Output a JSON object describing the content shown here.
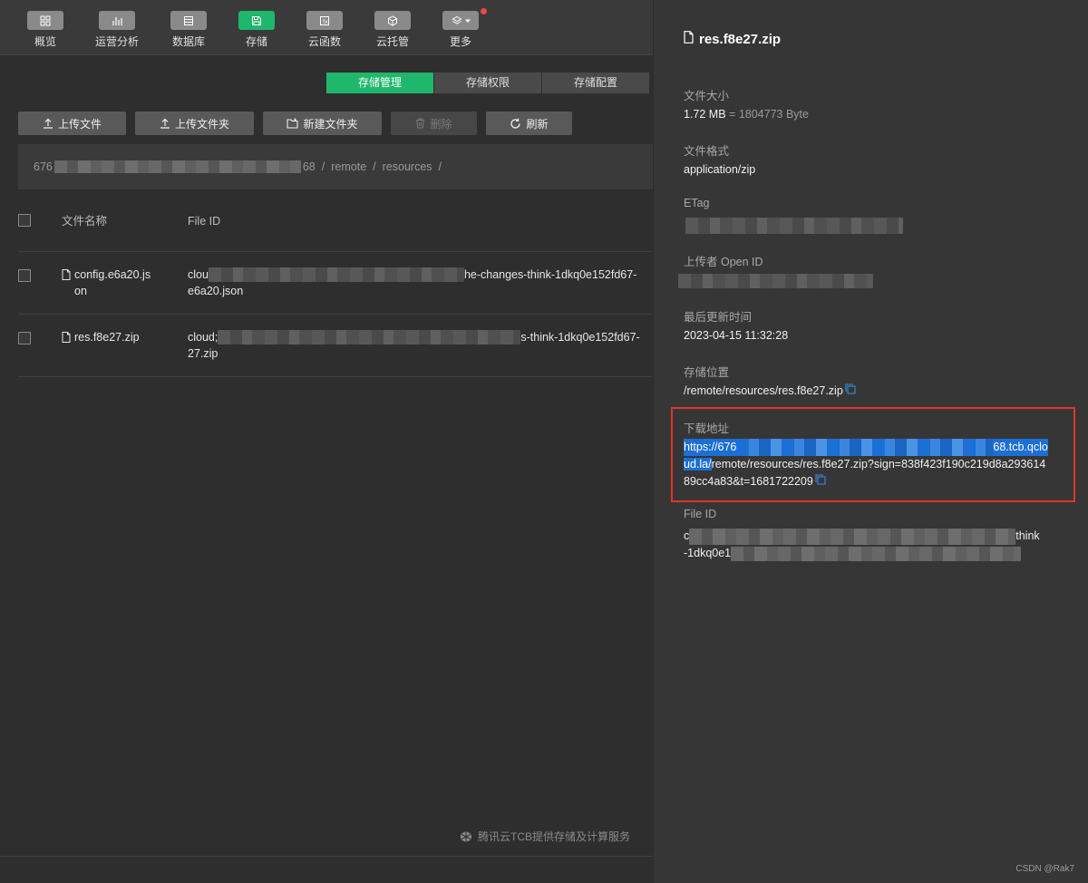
{
  "nav": {
    "items": [
      {
        "label": "概览",
        "icon": "grid-icon"
      },
      {
        "label": "运营分析",
        "icon": "bar-chart-icon"
      },
      {
        "label": "数据库",
        "icon": "database-icon"
      },
      {
        "label": "存储",
        "icon": "save-icon",
        "active": true
      },
      {
        "label": "云函数",
        "icon": "function-icon"
      },
      {
        "label": "云托管",
        "icon": "cube-icon"
      },
      {
        "label": "更多",
        "icon": "layers-icon"
      }
    ]
  },
  "tabs": [
    {
      "label": "存储管理",
      "active": true
    },
    {
      "label": "存储权限"
    },
    {
      "label": "存储配置"
    }
  ],
  "toolbar": {
    "upload_file": "上传文件",
    "upload_folder": "上传文件夹",
    "new_folder": "新建文件夹",
    "delete": "删除",
    "refresh": "刷新"
  },
  "breadcrumb": {
    "prefix": "676",
    "suffix": "68",
    "parts": [
      "remote",
      "resources"
    ],
    "separator": "/"
  },
  "table": {
    "headers": {
      "name": "文件名称",
      "file_id": "File ID"
    },
    "rows": [
      {
        "name_l1": "config.e6a20.js",
        "name_l2": "on",
        "id_prefix": "clou",
        "id_suffix": "he-changes-think-1dkq0e152fd67-",
        "id_l2": "e6a20.json"
      },
      {
        "name_l1": "res.f8e27.zip",
        "name_l2": "",
        "id_prefix": "cloud;",
        "id_suffix": "s-think-1dkq0e152fd67-",
        "id_l2": "27.zip"
      }
    ]
  },
  "footer": {
    "brand": "腾讯云TCB提供存储及计算服务"
  },
  "panel": {
    "title": "res.f8e27.zip",
    "size_label": "文件大小",
    "size_value": "1.72 MB",
    "size_bytes": "= 1804773 Byte",
    "format_label": "文件格式",
    "format_value": "application/zip",
    "etag_label": "ETag",
    "uploader_label": "上传者 Open ID",
    "updated_label": "最后更新时间",
    "updated_value": "2023-04-15 11:32:28",
    "location_label": "存储位置",
    "location_value": "/remote/resources/res.f8e27.zip",
    "download_label": "下载地址",
    "download_l1_a": "https://676",
    "download_l1_b": "68.tcb.qclo",
    "download_l2_sel": "ud.la/",
    "download_l2_rest": "remote/resources/res.f8e27.zip?sign=838f423f190c219d8a293614",
    "download_l3": "89cc4a83&t=1681722209",
    "fileid_label": "File ID",
    "fileid_l1_a": "c",
    "fileid_l1_b": "think",
    "fileid_l2_a": "-1dkq0e1"
  },
  "watermark": "CSDN @Rak7"
}
